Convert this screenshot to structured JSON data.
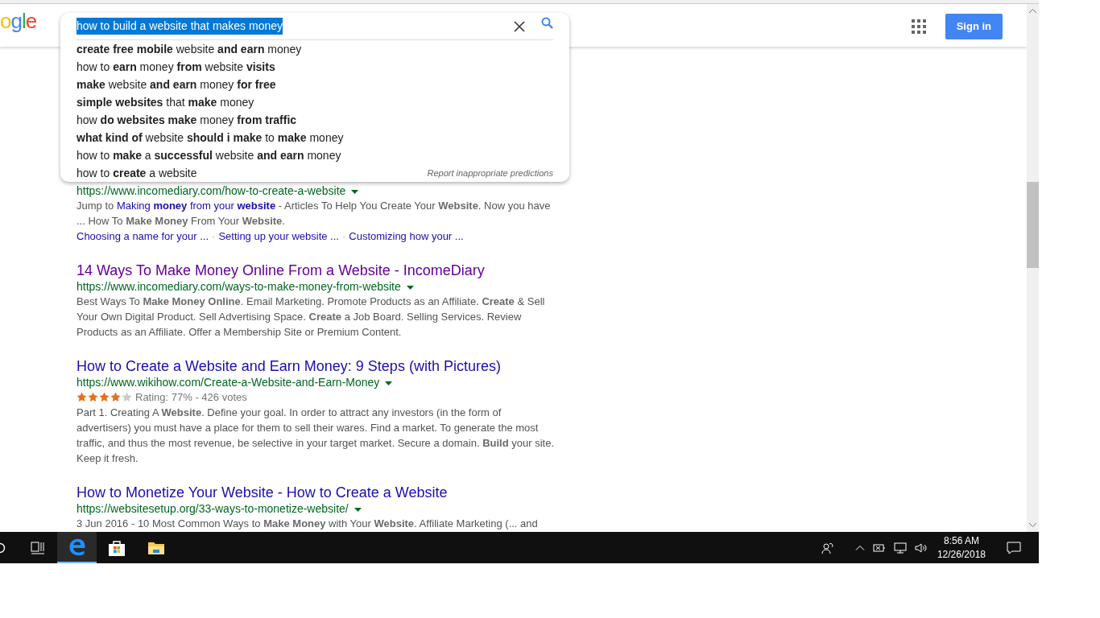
{
  "logo": {
    "text": "ogle"
  },
  "search": {
    "value": "how to build a website that makes money",
    "text_selected": true
  },
  "suggestions": [
    {
      "text": "**create free mobile** website **and earn** money"
    },
    {
      "text": "how to **earn** money **from** website **visits**"
    },
    {
      "text": "**make** website **and earn** money **for free**"
    },
    {
      "text": "**simple websites** that **make** money"
    },
    {
      "text": "how **do websites make** money **from traffic**"
    },
    {
      "text": "**what kind of** website **should i make** to **make** money"
    },
    {
      "text": "how to **make** a **successful** website **and earn** money"
    },
    {
      "text": "how to **create** a website"
    }
  ],
  "report_link": "Report inappropriate predictions",
  "sign_in": "Sign in",
  "results": [
    {
      "url": "https://www.incomediary.com/how-to-create-a-website",
      "snippet": [
        {
          "kind": "text",
          "text": "Jump to"
        },
        {
          "kind": "link",
          "text": "Making **money** from your **website**"
        },
        {
          "kind": "text",
          "text": "- Articles To Help You Create Your **Website**. Now you have ... How To **Make Money** From Your **Website**."
        }
      ],
      "sitelinks": [
        {
          "kind": "link",
          "text": "Choosing a name for your ..."
        },
        {
          "kind": "separator",
          "text": "·"
        },
        {
          "kind": "link",
          "text": "Setting up your website ..."
        },
        {
          "kind": "separator",
          "text": "·"
        },
        {
          "kind": "link",
          "text": "Customizing how your ..."
        }
      ]
    },
    {
      "visited": true,
      "title": "14 Ways To Make Money Online From a Website - IncomeDiary",
      "url": "https://www.incomediary.com/ways-to-make-money-from-website",
      "snippet": [
        {
          "kind": "text",
          "text": "Best Ways To **Make Money Online**. Email Marketing. Promote Products as an Affiliate. **Create** & Sell Your Own Digital Product. Sell Advertising Space. **Create** a Job Board. Selling Services. Review Products as an Affiliate. Offer a Membership Site or Premium Content."
        }
      ]
    },
    {
      "visited": false,
      "title": "How to Create a Website and Earn Money: 9 Steps (with Pictures)",
      "url": "https://www.wikihow.com/Create-a-Website-and-Earn-Money",
      "stars": 4,
      "rating": "Rating: 77% - 426 votes",
      "snippet": [
        {
          "kind": "text",
          "text": "Part 1. Creating A **Website**. Define your goal. In order to attract any investors (in the form of advertisers) you must have a place for them to sell their wares. Find a market. To generate the most traffic, and thus the most revenue, be selective in your target market. Secure a domain. **Build** your site. Keep it fresh."
        }
      ]
    },
    {
      "visited": false,
      "title": "How to Monetize Your Website - How to Create a Website",
      "url": "https://websitesetup.org/33-ways-to-monetize-website/",
      "snippet": [
        {
          "kind": "text",
          "text": "3 Jun 2016 - 10 Most Common Ways to **Make Money** with Your **Website**. Affiliate Marketing (... and"
        }
      ]
    }
  ],
  "taskbar": {
    "apps": [
      {
        "kind": "search",
        "selected": false
      },
      {
        "kind": "task-view",
        "selected": false
      },
      {
        "kind": "edge",
        "selected": true
      },
      {
        "kind": "store",
        "selected": false
      },
      {
        "kind": "explorer",
        "selected": false
      }
    ],
    "time": "8:56 AM",
    "date": "12/26/2018"
  }
}
